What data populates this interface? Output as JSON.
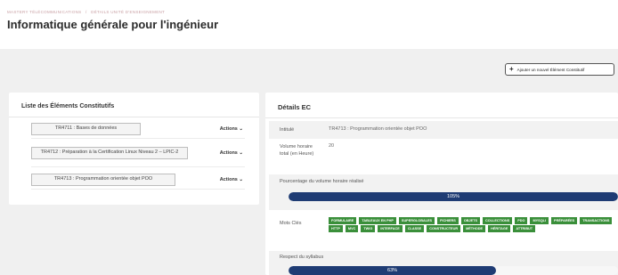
{
  "breadcrumb": [
    "MASTERY TÉLÉCOMMUNICATIONS",
    "/",
    "DÉTAILS UNITÉ D'ENSEIGNEMENT"
  ],
  "page_title": "Informatique générale pour l'ingénieur",
  "add_button_label": "Ajouter un nouvel Élément Constitutif",
  "left_panel": {
    "title": "Liste des Éléments Constitutifs",
    "items": [
      {
        "label": "TR4711 : Bases de données",
        "actions": "Actions"
      },
      {
        "label": "TR4712 : Préparation à la Certification Linux Niveau 2 – LPIC-2",
        "actions": "Actions"
      },
      {
        "label": "TR4713 : Programmation orientée objet POO",
        "actions": "Actions"
      }
    ]
  },
  "details": {
    "title": "Détails EC",
    "intitule_label": "Intitulé",
    "intitule_value": "TR4713 : Programmation orientée objet POO",
    "volume_label": "Volume horaire total (en Heure)",
    "volume_value": "20",
    "pourcentage_label": "Pourcentage du volume horaire réalisé",
    "pourcentage_text": "105%",
    "pourcentage_value": 100,
    "mots_cles_label": "Mots Clés",
    "keywords": [
      "FORMULAIRE",
      "TABLEAUX EN PHP",
      "SUPERGLOBALES",
      "FICHIERS",
      "OBJETS",
      "COLLECTIONS",
      "PDO",
      "MYSQLI",
      "PRÉPARÉES",
      "TRANSACTIONS",
      "HTTP",
      "MVC",
      "TWIG",
      "INTERFACE",
      "CLASSE",
      "CONSTRUCTEUR",
      "MÉTHODE",
      "HÉRITAGE",
      "ATTRIBUT"
    ],
    "respect_label": "Respect du syllabus",
    "respect_text": "63%",
    "respect_value": 63
  },
  "colors": {
    "progress": "#1f3c74",
    "keyword": "#3a8f3a",
    "background": "#f0f0f0"
  },
  "icons": {
    "add": "plus-icon",
    "actions": "chevron-down-icon"
  }
}
